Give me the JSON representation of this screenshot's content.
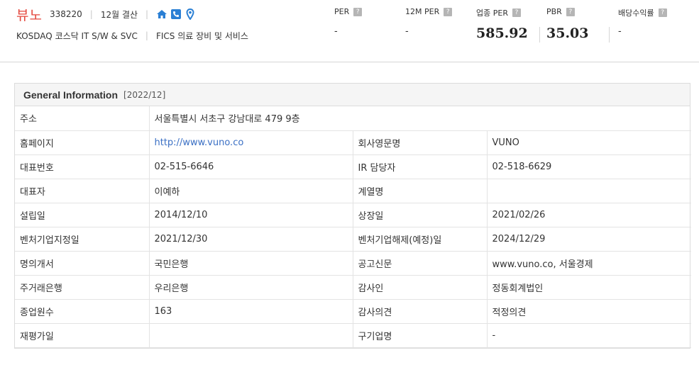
{
  "header": {
    "company_name": "뷰노",
    "code": "338220",
    "fiscal": "12월 결산",
    "market_line": "KOSDAQ  코스닥 IT S/W & SVC",
    "fics_line": "FICS 의료 장비 및 서비스",
    "icons": [
      "home-icon",
      "phone-icon",
      "map-pin-icon"
    ],
    "help_glyph": "?",
    "colors": {
      "accent": "#e4473d",
      "icon_blue": "#2a7fd4"
    }
  },
  "metrics": [
    {
      "label": "PER",
      "value": "-"
    },
    {
      "label": "12M PER",
      "value": "-"
    },
    {
      "label": "업종 PER",
      "value": "585.92"
    },
    {
      "label": "PBR",
      "value": "35.03"
    },
    {
      "label": "배당수익률",
      "value": "-"
    }
  ],
  "info": {
    "title": "General Information",
    "date": "[2022/12]",
    "address_label": "주소",
    "address_value": "서울특별시 서초구 강남대로 479 9층",
    "rows": [
      {
        "k1": "홈페이지",
        "v1": "http://www.vuno.co",
        "k2": "회사영문명",
        "v2": "VUNO"
      },
      {
        "k1": "대표번호",
        "v1": "02-515-6646",
        "k2": "IR 담당자",
        "v2": "02-518-6629"
      },
      {
        "k1": "대표자",
        "v1": "이예하",
        "k2": "계열명",
        "v2": ""
      },
      {
        "k1": "설립일",
        "v1": "2014/12/10",
        "k2": "상장일",
        "v2": "2021/02/26"
      },
      {
        "k1": "벤처기업지정일",
        "v1": "2021/12/30",
        "k2": "벤처기업해제(예정)일",
        "v2": "2024/12/29"
      },
      {
        "k1": "명의개서",
        "v1": "국민은행",
        "k2": "공고신문",
        "v2": "www.vuno.co, 서울경제"
      },
      {
        "k1": "주거래은행",
        "v1": "우리은행",
        "k2": "감사인",
        "v2": "정동회계법인"
      },
      {
        "k1": "종업원수",
        "v1": "163",
        "k2": "감사의견",
        "v2": "적정의견"
      },
      {
        "k1": "재평가일",
        "v1": "",
        "k2": "구기업명",
        "v2": "-"
      }
    ]
  }
}
